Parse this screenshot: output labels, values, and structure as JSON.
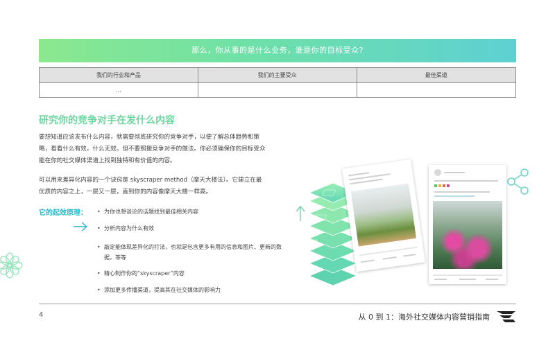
{
  "banner": {
    "question": "那么，你从事的是什么业务，谁是你的目标受众?"
  },
  "table": {
    "headers": [
      "我们的行业和产品",
      "我们的主要受众",
      "最佳渠道"
    ],
    "row": [
      "…",
      "",
      ""
    ]
  },
  "section": {
    "heading": "研究你的竞争对手在发什么内容",
    "para1": "要想知道应该发布什么内容，就需要彻底研究你的竞争对手，以便了解总体趋势和策略，看看什么有效，什么无效。但不要照搬竞争对手的做法。你必须确保你的目标受众能在你的社交媒体渠道上找到独特和有价值的内容。",
    "para2": "可以用来差异化内容的一个诀窍是 skyscraper method（摩天大楼法）。它建立在最优质的内容之上，一层又一层，直到你的内容像摩天大楼一样高。"
  },
  "principle": {
    "label": "它的起效原理：",
    "bullets": [
      "为你也想谈论的话题找到最佳相关内容",
      "分析内容为什么有效",
      "敲定能体现差异化的打法，也就是包含更多有用的信息和图片、更新的数据，等等",
      "精心制作你的“skyscraper”内容",
      "添加更多传播渠道，提高其在社交媒体的影响力"
    ]
  },
  "footer": {
    "page_number": "4",
    "title": "从 0 到 1：海外社交媒体内容营销指南"
  },
  "colors": {
    "accent_green": "#6bd6a0",
    "accent_teal": "#2bb9c9"
  },
  "icons": [
    "flower-icon",
    "share-icon",
    "up-arrow-icon",
    "right-arrow-icon",
    "brand-logo-icon"
  ]
}
